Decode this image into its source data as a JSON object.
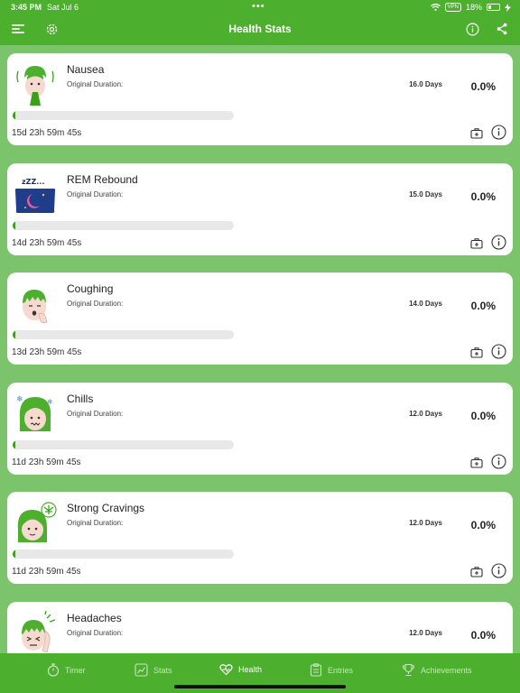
{
  "status_bar": {
    "time": "3:45 PM",
    "date": "Sat Jul 6",
    "vpn": "VPN",
    "battery": "18%"
  },
  "header": {
    "title": "Health Stats",
    "icons": [
      "menu-icon",
      "gear-icon",
      "info-icon",
      "share-icon"
    ]
  },
  "cards": [
    {
      "name": "Nausea",
      "orig_label": "Original Duration:",
      "days": "16.0 Days",
      "percent": "0.0%",
      "progress": 0.01,
      "remaining": "15d 23h 59m 45s",
      "illustration": "nausea-face"
    },
    {
      "name": "REM Rebound",
      "orig_label": "Original Duration:",
      "days": "15.0 Days",
      "percent": "0.0%",
      "progress": 0.01,
      "remaining": "14d 23h 59m 45s",
      "illustration": "pillow-moon"
    },
    {
      "name": "Coughing",
      "orig_label": "Original Duration:",
      "days": "14.0 Days",
      "percent": "0.0%",
      "progress": 0.01,
      "remaining": "13d 23h 59m 45s",
      "illustration": "coughing-face"
    },
    {
      "name": "Chills",
      "orig_label": "Original Duration:",
      "days": "12.0 Days",
      "percent": "0.0%",
      "progress": 0.01,
      "remaining": "11d 23h 59m 45s",
      "illustration": "chills-face"
    },
    {
      "name": "Strong Cravings",
      "orig_label": "Original Duration:",
      "days": "12.0 Days",
      "percent": "0.0%",
      "progress": 0.01,
      "remaining": "11d 23h 59m 45s",
      "illustration": "craving-face"
    },
    {
      "name": "Headaches",
      "orig_label": "Original Duration:",
      "days": "12.0 Days",
      "percent": "0.0%",
      "progress": 0.01,
      "remaining": "",
      "illustration": "headache-face"
    }
  ],
  "tabs": [
    {
      "label": "Timer",
      "icon": "stopwatch-icon",
      "active": false
    },
    {
      "label": "Stats",
      "icon": "chart-icon",
      "active": false
    },
    {
      "label": "Health",
      "icon": "heart-icon",
      "active": true
    },
    {
      "label": "Entries",
      "icon": "clipboard-icon",
      "active": false
    },
    {
      "label": "Achievements",
      "icon": "trophy-icon",
      "active": false
    }
  ],
  "colors": {
    "brand_green": "#4caf2e",
    "background_green": "#7cc46c",
    "progress_green": "#3aa017"
  }
}
